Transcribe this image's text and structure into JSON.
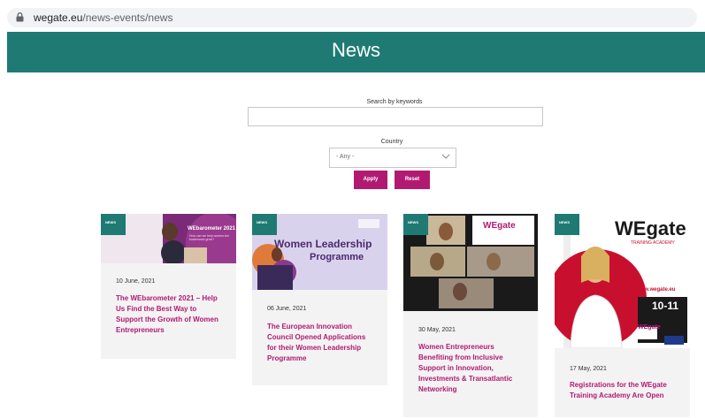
{
  "browser": {
    "url_host": "wegate.eu",
    "url_path": "/news-events/news"
  },
  "page": {
    "title": "News"
  },
  "search": {
    "keywords_label": "Search by keywords",
    "keywords_value": "",
    "country_label": "Country",
    "country_value": "- Any -",
    "apply_label": "Apply",
    "reset_label": "Reset"
  },
  "colors": {
    "teal": "#1f7a74",
    "magenta": "#b21a72",
    "card_bg": "#f3f3f3"
  },
  "cards": [
    {
      "badge": "NEWS",
      "date": "10 June, 2021",
      "title": "The WEbarometer 2021 – Help Us Find the Best Way to Support the Growth of Women Entrepreneurs",
      "image_text": [
        "WEbarometer 2021",
        "How can we help women-led businesses grow?"
      ]
    },
    {
      "badge": "NEWS",
      "date": "06 June, 2021",
      "title": "The European Innovation Council Opened Applications for their Women Leadership Programme",
      "image_text": [
        "Women Leadership",
        "Programme"
      ]
    },
    {
      "badge": "NEWS",
      "date": "30 May, 2021",
      "title": "Women Entrepreneurs Benefiting from Inclusive Support in Innovation, Investments & Transatlantic Networking",
      "image_text": [
        "WEgate"
      ]
    },
    {
      "badge": "NEWS",
      "date": "17 May, 2021",
      "title": "Registrations for the WEgate Training Academy Are Open",
      "image_text": [
        "WEgate",
        "TRAINING ACADEMY",
        "www.wegate.eu",
        "10-11",
        "WEgate"
      ]
    }
  ]
}
